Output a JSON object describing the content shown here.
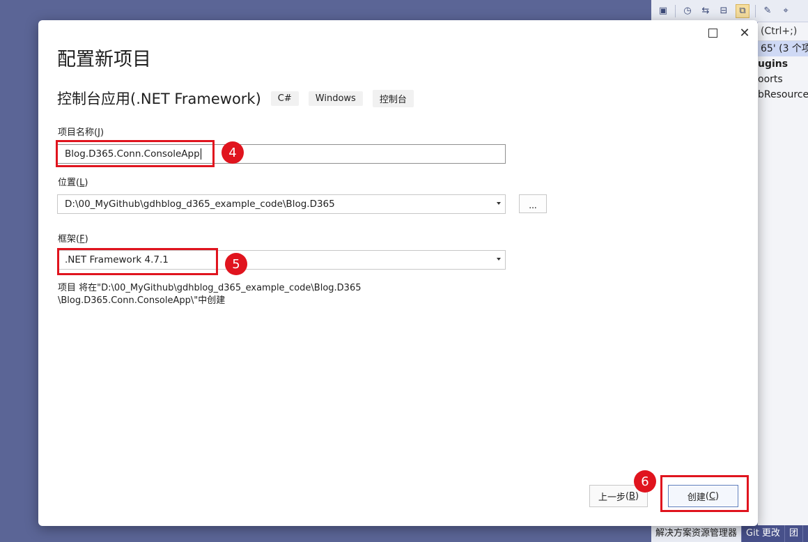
{
  "background": {
    "toolbar_icons": [
      "build-icon",
      "history-icon",
      "navigate-icon",
      "collapse-icon",
      "sync-view-icon",
      "properties-icon",
      "pin-icon"
    ],
    "search_hint": "(Ctrl+;)",
    "solution_label": "65' (3 个项",
    "tree_items": [
      "ugins",
      "oorts",
      "bResource"
    ],
    "bottom_tabs": [
      "解决方案资源管理器",
      "Git 更改",
      "团"
    ]
  },
  "dialog": {
    "title": "配置新项目",
    "template_name": "控制台应用(.NET Framework)",
    "tags": [
      "C#",
      "Windows",
      "控制台"
    ],
    "project_name": {
      "label": "项目名称",
      "accel": "J",
      "value": "Blog.D365.Conn.ConsoleApp"
    },
    "location": {
      "label": "位置",
      "accel": "L",
      "value": "D:\\00_MyGithub\\gdhblog_d365_example_code\\Blog.D365",
      "browse_label": "..."
    },
    "framework": {
      "label": "框架",
      "accel": "F",
      "value": ".NET Framework 4.7.1"
    },
    "path_info_line1": "项目 将在\"D:\\00_MyGithub\\gdhblog_d365_example_code\\Blog.D365",
    "path_info_line2": "\\Blog.D365.Conn.ConsoleApp\\\"中创建",
    "buttons": {
      "back_label": "上一步",
      "back_accel": "B",
      "create_label": "创建",
      "create_accel": "C"
    }
  },
  "annotations": {
    "step_4": "4",
    "step_5": "5",
    "step_6": "6",
    "color": "#e0141e"
  }
}
